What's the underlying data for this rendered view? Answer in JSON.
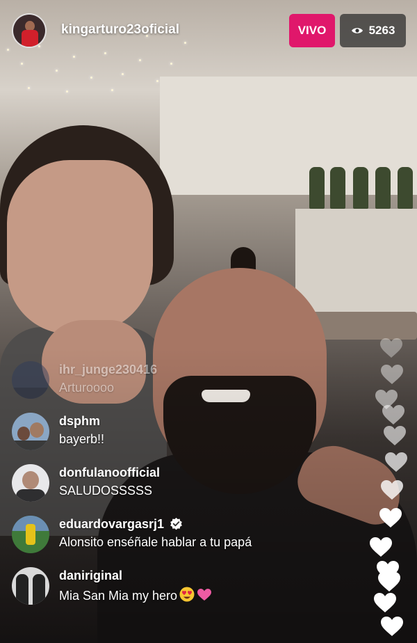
{
  "header": {
    "username": "kingarturo23oficial",
    "live_label": "VIVO",
    "viewer_count": "5263"
  },
  "comments": [
    {
      "username": "ihr_junge230416",
      "text": "Arturoooo",
      "faded": true,
      "verified": false
    },
    {
      "username": "dsphm",
      "text": "bayerb!!",
      "faded": false,
      "verified": false
    },
    {
      "username": "donfulanoofficial",
      "text": "SALUDOSSSSS",
      "faded": false,
      "verified": false
    },
    {
      "username": "eduardovargasrj1",
      "text": "Alonsito enséñale hablar a tu papá",
      "faded": false,
      "verified": true
    },
    {
      "username": "daniriginal",
      "text": "Mia San Mia my hero",
      "faded": false,
      "verified": false
    }
  ],
  "colors": {
    "live": "#e0176b",
    "viewer_badge": "#282828",
    "heart": "#ffffff"
  },
  "icons": [
    "eye-icon",
    "verified-icon",
    "heart-icon",
    "heart-eyes-emoji",
    "pink-heart-emoji"
  ]
}
